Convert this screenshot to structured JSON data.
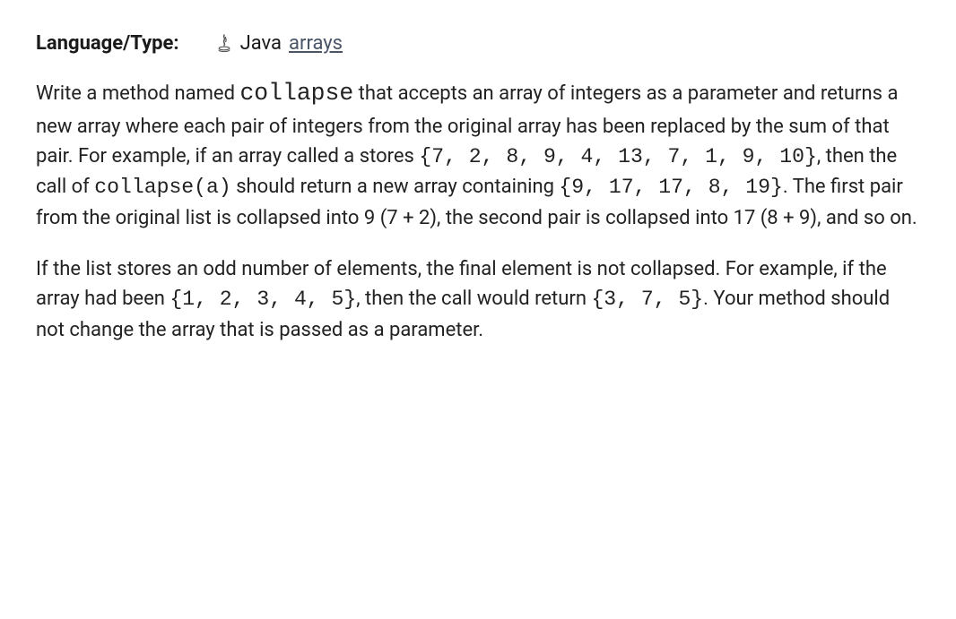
{
  "header": {
    "label": "Language/Type:",
    "language": "Java",
    "link_text": "arrays"
  },
  "para1": {
    "t1": "Write a method named ",
    "method_name": "collapse",
    "t2": " that accepts an array of integers as a parameter and returns a new array where each pair of integers from the original array has been replaced by the sum of that pair. For example, if an array called a stores ",
    "arr1": "{7, 2, 8, 9, 4, 13, 7, 1, 9, 10}",
    "t3": ", then the call of ",
    "call": "collapse(a)",
    "t4": " should return a new array containing ",
    "arr2": "{9, 17, 17, 8, 19}",
    "t5": ". The first pair from the original list is collapsed into 9 (7 + 2), the second pair is collapsed into 17 (8 + 9), and so on."
  },
  "para2": {
    "t1": "If the list stores an odd number of elements, the final element is not collapsed. For example, if the array had been ",
    "arr1": "{1, 2, 3, 4, 5}",
    "t2": ", then the call would return ",
    "arr2": "{3, 7, 5}",
    "t3": ". Your method should not change the array that is passed as a parameter."
  }
}
